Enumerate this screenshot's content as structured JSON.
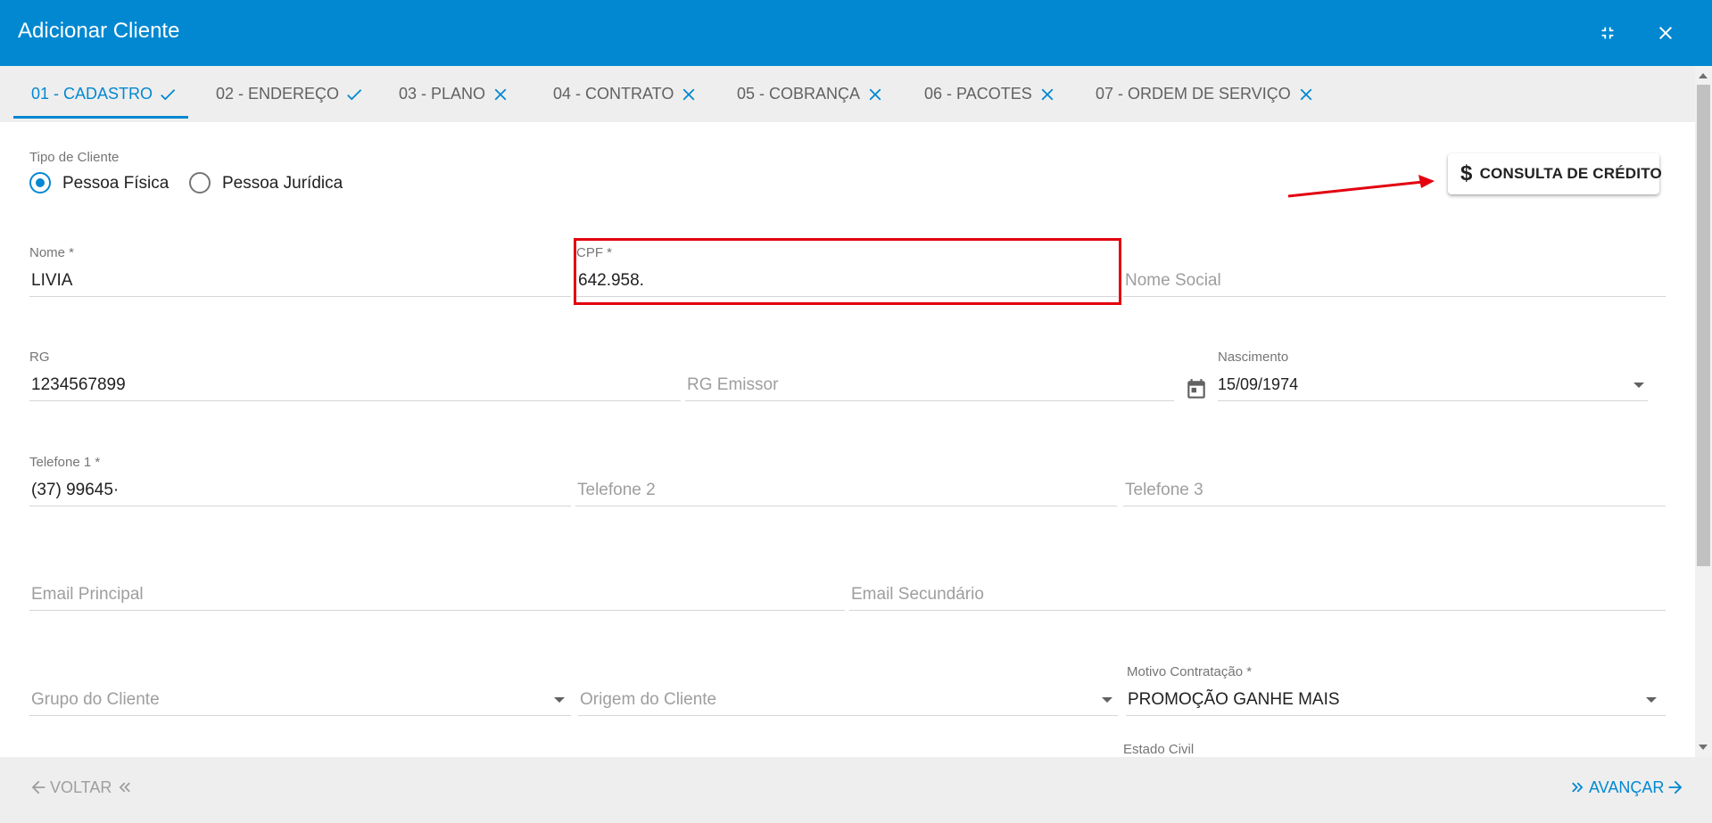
{
  "window": {
    "title": "Adicionar Cliente",
    "header_color": "#0288d1",
    "icons": {
      "minimize": "collapse-icon",
      "close": "close-icon"
    }
  },
  "tabs": [
    {
      "label": "01 - CADASTRO",
      "status": "done",
      "active": true
    },
    {
      "label": "02 - ENDEREÇO",
      "status": "done",
      "active": false
    },
    {
      "label": "03 - PLANO",
      "status": "pending",
      "active": false
    },
    {
      "label": "04 - CONTRATO",
      "status": "pending",
      "active": false
    },
    {
      "label": "05 - COBRANÇA",
      "status": "pending",
      "active": false
    },
    {
      "label": "06 - PACOTES",
      "status": "pending",
      "active": false
    },
    {
      "label": "07 - ORDEM DE SERVIÇO",
      "status": "pending",
      "active": false
    }
  ],
  "form": {
    "tipo_cliente": {
      "label": "Tipo de Cliente",
      "options": [
        "Pessoa Física",
        "Pessoa Jurídica"
      ],
      "selected": "Pessoa Física"
    },
    "credit_button": {
      "label": "CONSULTA DE CRÉDITO",
      "icon": "dollar-icon"
    },
    "nome": {
      "label": "Nome *",
      "value": "LIVIA"
    },
    "cpf": {
      "label": "CPF *",
      "value": "642.958."
    },
    "nome_social": {
      "placeholder": "Nome Social"
    },
    "rg": {
      "label": "RG",
      "value": "1234567899"
    },
    "rg_emissor": {
      "placeholder": "RG Emissor"
    },
    "nascimento": {
      "label": "Nascimento",
      "value": "15/09/1974",
      "icon": "calendar-icon"
    },
    "telefone1": {
      "label": "Telefone 1 *",
      "value": "(37) 99645·"
    },
    "telefone2": {
      "placeholder": "Telefone 2"
    },
    "telefone3": {
      "placeholder": "Telefone 3"
    },
    "email_principal": {
      "placeholder": "Email Principal"
    },
    "email_secundario": {
      "placeholder": "Email Secundário"
    },
    "grupo_cliente": {
      "placeholder": "Grupo do Cliente"
    },
    "origem_cliente": {
      "placeholder": "Origem do Cliente"
    },
    "motivo_contratacao": {
      "label": "Motivo Contratação *",
      "value": "PROMOÇÃO GANHE MAIS"
    },
    "estado_civil": {
      "label": "Estado Civil"
    }
  },
  "annotations": {
    "highlight_color": "#e3000f"
  },
  "footer": {
    "back_label": "VOLTAR",
    "next_label": "AVANÇAR"
  }
}
